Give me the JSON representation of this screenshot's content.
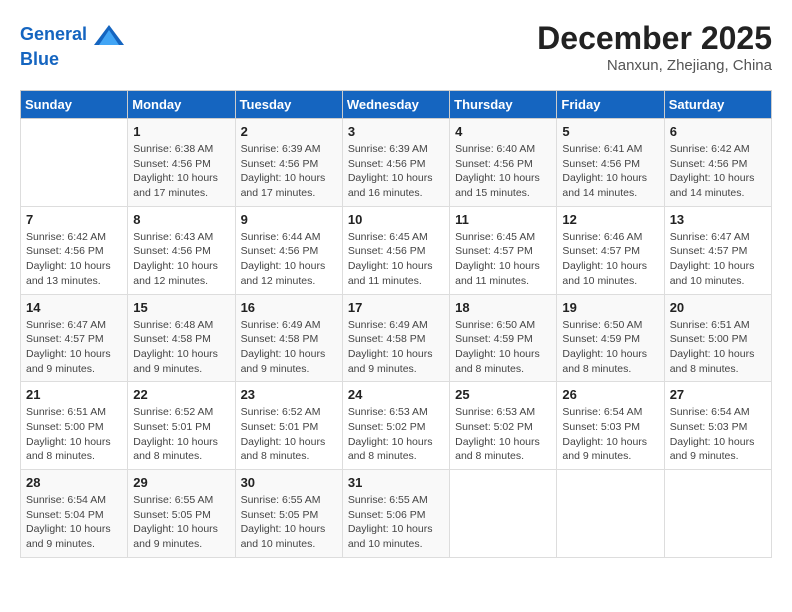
{
  "header": {
    "logo_line1": "General",
    "logo_line2": "Blue",
    "month": "December 2025",
    "location": "Nanxun, Zhejiang, China"
  },
  "days_of_week": [
    "Sunday",
    "Monday",
    "Tuesday",
    "Wednesday",
    "Thursday",
    "Friday",
    "Saturday"
  ],
  "weeks": [
    [
      {
        "day": "",
        "info": ""
      },
      {
        "day": "1",
        "info": "Sunrise: 6:38 AM\nSunset: 4:56 PM\nDaylight: 10 hours\nand 17 minutes."
      },
      {
        "day": "2",
        "info": "Sunrise: 6:39 AM\nSunset: 4:56 PM\nDaylight: 10 hours\nand 17 minutes."
      },
      {
        "day": "3",
        "info": "Sunrise: 6:39 AM\nSunset: 4:56 PM\nDaylight: 10 hours\nand 16 minutes."
      },
      {
        "day": "4",
        "info": "Sunrise: 6:40 AM\nSunset: 4:56 PM\nDaylight: 10 hours\nand 15 minutes."
      },
      {
        "day": "5",
        "info": "Sunrise: 6:41 AM\nSunset: 4:56 PM\nDaylight: 10 hours\nand 14 minutes."
      },
      {
        "day": "6",
        "info": "Sunrise: 6:42 AM\nSunset: 4:56 PM\nDaylight: 10 hours\nand 14 minutes."
      }
    ],
    [
      {
        "day": "7",
        "info": "Sunrise: 6:42 AM\nSunset: 4:56 PM\nDaylight: 10 hours\nand 13 minutes."
      },
      {
        "day": "8",
        "info": "Sunrise: 6:43 AM\nSunset: 4:56 PM\nDaylight: 10 hours\nand 12 minutes."
      },
      {
        "day": "9",
        "info": "Sunrise: 6:44 AM\nSunset: 4:56 PM\nDaylight: 10 hours\nand 12 minutes."
      },
      {
        "day": "10",
        "info": "Sunrise: 6:45 AM\nSunset: 4:56 PM\nDaylight: 10 hours\nand 11 minutes."
      },
      {
        "day": "11",
        "info": "Sunrise: 6:45 AM\nSunset: 4:57 PM\nDaylight: 10 hours\nand 11 minutes."
      },
      {
        "day": "12",
        "info": "Sunrise: 6:46 AM\nSunset: 4:57 PM\nDaylight: 10 hours\nand 10 minutes."
      },
      {
        "day": "13",
        "info": "Sunrise: 6:47 AM\nSunset: 4:57 PM\nDaylight: 10 hours\nand 10 minutes."
      }
    ],
    [
      {
        "day": "14",
        "info": "Sunrise: 6:47 AM\nSunset: 4:57 PM\nDaylight: 10 hours\nand 9 minutes."
      },
      {
        "day": "15",
        "info": "Sunrise: 6:48 AM\nSunset: 4:58 PM\nDaylight: 10 hours\nand 9 minutes."
      },
      {
        "day": "16",
        "info": "Sunrise: 6:49 AM\nSunset: 4:58 PM\nDaylight: 10 hours\nand 9 minutes."
      },
      {
        "day": "17",
        "info": "Sunrise: 6:49 AM\nSunset: 4:58 PM\nDaylight: 10 hours\nand 9 minutes."
      },
      {
        "day": "18",
        "info": "Sunrise: 6:50 AM\nSunset: 4:59 PM\nDaylight: 10 hours\nand 8 minutes."
      },
      {
        "day": "19",
        "info": "Sunrise: 6:50 AM\nSunset: 4:59 PM\nDaylight: 10 hours\nand 8 minutes."
      },
      {
        "day": "20",
        "info": "Sunrise: 6:51 AM\nSunset: 5:00 PM\nDaylight: 10 hours\nand 8 minutes."
      }
    ],
    [
      {
        "day": "21",
        "info": "Sunrise: 6:51 AM\nSunset: 5:00 PM\nDaylight: 10 hours\nand 8 minutes."
      },
      {
        "day": "22",
        "info": "Sunrise: 6:52 AM\nSunset: 5:01 PM\nDaylight: 10 hours\nand 8 minutes."
      },
      {
        "day": "23",
        "info": "Sunrise: 6:52 AM\nSunset: 5:01 PM\nDaylight: 10 hours\nand 8 minutes."
      },
      {
        "day": "24",
        "info": "Sunrise: 6:53 AM\nSunset: 5:02 PM\nDaylight: 10 hours\nand 8 minutes."
      },
      {
        "day": "25",
        "info": "Sunrise: 6:53 AM\nSunset: 5:02 PM\nDaylight: 10 hours\nand 8 minutes."
      },
      {
        "day": "26",
        "info": "Sunrise: 6:54 AM\nSunset: 5:03 PM\nDaylight: 10 hours\nand 9 minutes."
      },
      {
        "day": "27",
        "info": "Sunrise: 6:54 AM\nSunset: 5:03 PM\nDaylight: 10 hours\nand 9 minutes."
      }
    ],
    [
      {
        "day": "28",
        "info": "Sunrise: 6:54 AM\nSunset: 5:04 PM\nDaylight: 10 hours\nand 9 minutes."
      },
      {
        "day": "29",
        "info": "Sunrise: 6:55 AM\nSunset: 5:05 PM\nDaylight: 10 hours\nand 9 minutes."
      },
      {
        "day": "30",
        "info": "Sunrise: 6:55 AM\nSunset: 5:05 PM\nDaylight: 10 hours\nand 10 minutes."
      },
      {
        "day": "31",
        "info": "Sunrise: 6:55 AM\nSunset: 5:06 PM\nDaylight: 10 hours\nand 10 minutes."
      },
      {
        "day": "",
        "info": ""
      },
      {
        "day": "",
        "info": ""
      },
      {
        "day": "",
        "info": ""
      }
    ]
  ]
}
